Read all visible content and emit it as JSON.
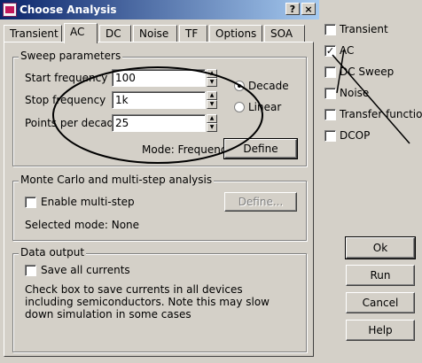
{
  "window": {
    "title": "Choose Analysis"
  },
  "tabs": [
    "Transient",
    "AC",
    "DC",
    "Noise",
    "TF",
    "Options",
    "SOA"
  ],
  "sweep": {
    "legend": "Sweep parameters",
    "start_label": "Start frequency",
    "start_value": "100",
    "stop_label": "Stop frequency",
    "stop_value": "1k",
    "points_label": "Points per decade",
    "points_value": "25",
    "decade_label": "Decade",
    "linear_label": "Linear",
    "mode_text": "Mode: Frequency",
    "define_label": "Define"
  },
  "monte_carlo": {
    "legend": "Monte Carlo and multi-step analysis",
    "enable_label": "Enable multi-step",
    "define_label": "Define...",
    "selected_mode": "Selected mode: None"
  },
  "data_output": {
    "legend": "Data output",
    "save_label": "Save all currents",
    "note": "Check box to save currents in all devices including semiconductors. Note this may slow down simulation in some cases"
  },
  "analysis_list": {
    "transient": "Transient",
    "ac": "AC",
    "dc_sweep": "DC Sweep",
    "noise": "Noise",
    "transfer_function": "Transfer function",
    "dcop": "DCOP"
  },
  "buttons": {
    "ok": "Ok",
    "run": "Run",
    "cancel": "Cancel",
    "help": "Help"
  }
}
